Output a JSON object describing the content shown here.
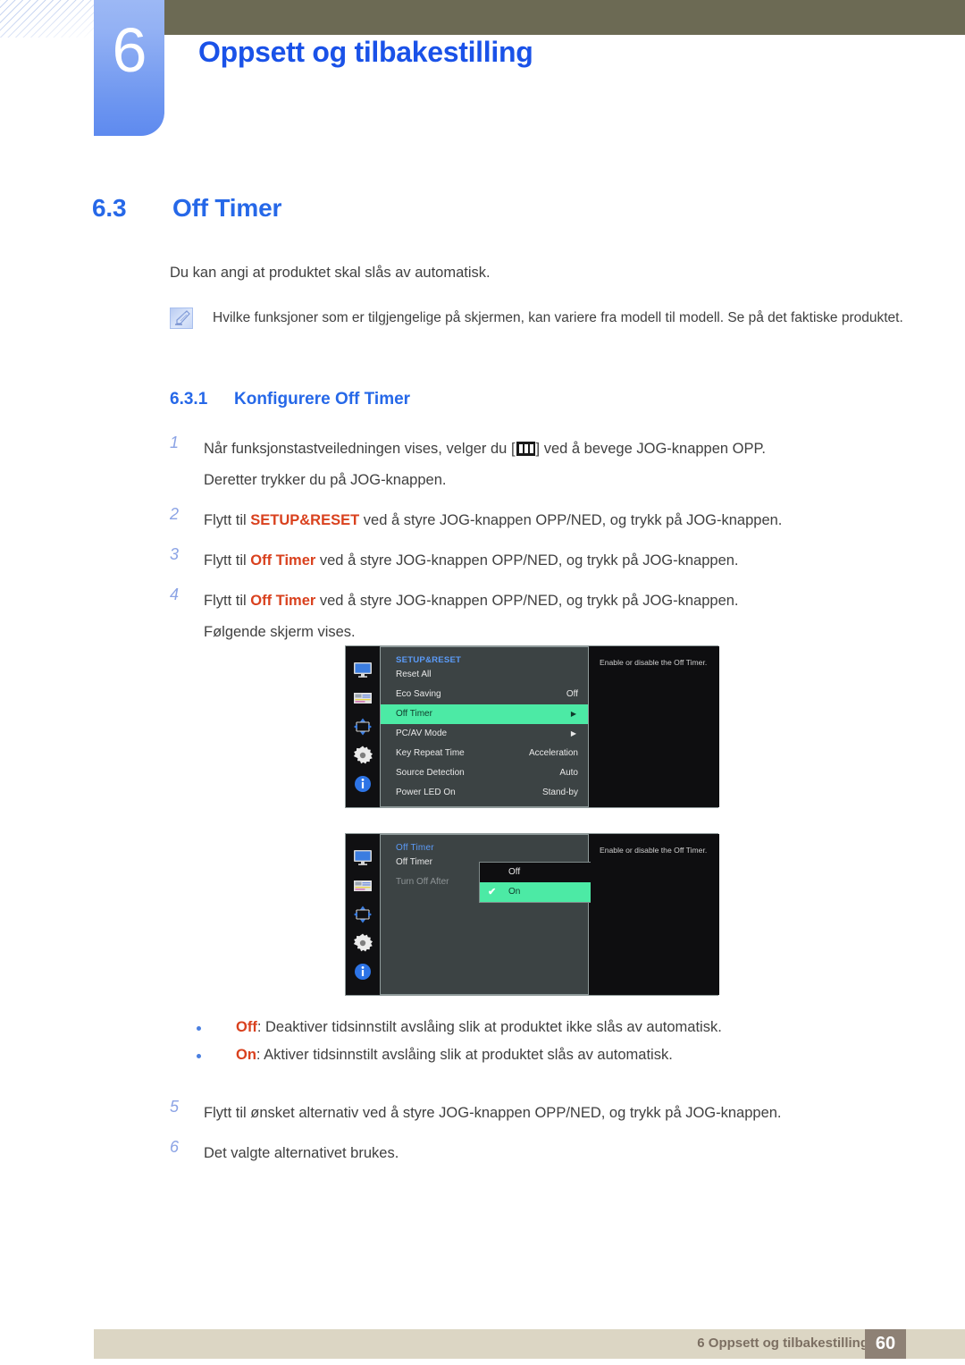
{
  "header": {
    "chapter_number": "6",
    "chapter_title": "Oppsett og tilbakestilling",
    "accent_blue": "#1a52e8",
    "olive": "#6c6a54"
  },
  "section": {
    "number": "6.3",
    "title": "Off Timer",
    "sub_number": "6.3.1",
    "sub_title": "Konfigurere Off Timer"
  },
  "intro": "Du kan angi at produktet skal slås av automatisk.",
  "note": {
    "icon": "note-pencil-icon",
    "text": "Hvilke funksjoner som er tilgjengelige på skjermen, kan variere fra modell til modell. Se på det faktiske produktet."
  },
  "steps": [
    {
      "num": "1",
      "pre": "Når funksjonstastveiledningen vises, velger du [",
      "glyph": "menu-icon",
      "post": "] ved å bevege JOG-knappen OPP.",
      "line2": "Deretter trykker du på JOG-knappen."
    },
    {
      "num": "2",
      "pre": "Flytt til ",
      "highlight": "SETUP&RESET",
      "post": " ved å styre JOG-knappen OPP/NED, og trykk på JOG-knappen."
    },
    {
      "num": "3",
      "pre": "Flytt til ",
      "highlight": "Off Timer",
      "post": " ved å styre JOG-knappen OPP/NED, og trykk på JOG-knappen."
    },
    {
      "num": "4",
      "pre": "Flytt til ",
      "highlight": "Off Timer",
      "post": " ved å styre JOG-knappen OPP/NED, og trykk på JOG-knappen.",
      "line2": "Følgende skjerm vises."
    }
  ],
  "osd_1": {
    "title": "SETUP&RESET",
    "description": "Enable or disable the Off Timer.",
    "sidebar_icons": [
      "monitor-icon",
      "picture-icon",
      "arrows-icon",
      "gear-icon",
      "info-icon"
    ],
    "rows": [
      {
        "label": "Reset All",
        "value": "",
        "arrow": false,
        "selected": false
      },
      {
        "label": "Eco Saving",
        "value": "Off",
        "arrow": false,
        "selected": false
      },
      {
        "label": "Off Timer",
        "value": "",
        "arrow": true,
        "selected": true
      },
      {
        "label": "PC/AV Mode",
        "value": "",
        "arrow": true,
        "selected": false
      },
      {
        "label": "Key Repeat Time",
        "value": "Acceleration",
        "arrow": false,
        "selected": false
      },
      {
        "label": "Source Detection",
        "value": "Auto",
        "arrow": false,
        "selected": false
      },
      {
        "label": "Power LED On",
        "value": "Stand-by",
        "arrow": false,
        "selected": false
      }
    ],
    "highlight_color": "#4ceaa5"
  },
  "osd_2": {
    "title": "Off Timer",
    "description": "Enable or disable the Off Timer.",
    "sidebar_icons": [
      "monitor-icon",
      "picture-icon",
      "arrows-icon",
      "gear-icon",
      "info-icon"
    ],
    "rows": [
      {
        "label": "Off Timer",
        "dim": false
      },
      {
        "label": "Turn Off After",
        "dim": true
      }
    ],
    "popup_options": [
      {
        "label": "Off",
        "selected": false,
        "checked": false
      },
      {
        "label": "On",
        "selected": true,
        "checked": true
      }
    ],
    "check_glyph": "✔",
    "highlight_color": "#4ceaa5"
  },
  "bullets": [
    {
      "term": "Off",
      "text": ": Deaktiver tidsinnstilt avslåing slik at produktet ikke slås av automatisk."
    },
    {
      "term": "On",
      "text": ": Aktiver tidsinnstilt avslåing slik at produktet slås av automatisk."
    }
  ],
  "steps_after": [
    {
      "num": "5",
      "text": "Flytt til ønsket alternativ ved å styre JOG-knappen OPP/NED, og trykk på JOG-knappen."
    },
    {
      "num": "6",
      "text": "Det valgte alternativet brukes."
    }
  ],
  "footer": {
    "text": "6 Oppsett og tilbakestilling",
    "page": "60"
  }
}
